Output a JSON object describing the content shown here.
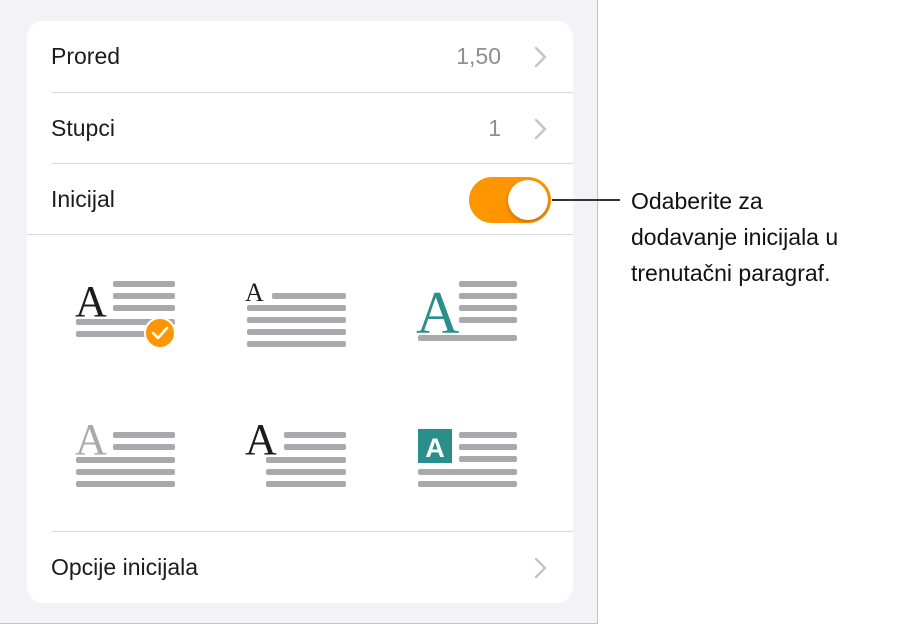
{
  "rows": {
    "line_spacing": {
      "label": "Prored",
      "value": "1,50"
    },
    "columns": {
      "label": "Stupci",
      "value": "1"
    },
    "drop_cap": {
      "label": "Inicijal",
      "enabled": true
    },
    "drop_cap_options": {
      "label": "Opcije inicijala"
    }
  },
  "drop_cap_styles": [
    {
      "name": "style-1",
      "letter": "A",
      "selected": true
    },
    {
      "name": "style-2",
      "letter": "A",
      "selected": false
    },
    {
      "name": "style-3",
      "letter": "A",
      "selected": false
    },
    {
      "name": "style-4",
      "letter": "A",
      "selected": false
    },
    {
      "name": "style-5",
      "letter": "A",
      "selected": false
    },
    {
      "name": "style-6",
      "letter": "A",
      "selected": false
    }
  ],
  "callout": {
    "line1": "Odaberite za",
    "line2": "dodavanje inicijala u",
    "line3": "trenutačni paragraf."
  },
  "colors": {
    "accent": "#ff9500",
    "teal": "#2a8f8a",
    "lines": "#a9a9ad"
  },
  "icons": {
    "chevron": "chevron-right-icon",
    "check": "checkmark-icon"
  }
}
